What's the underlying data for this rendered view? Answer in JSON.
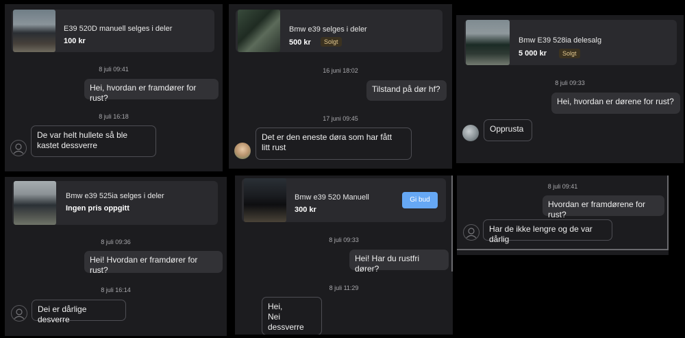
{
  "panels": [
    {
      "listing": {
        "title": "E39 520D manuell selges i deler",
        "price": "100 kr"
      },
      "messages": [
        {
          "time": "8 juli 09:41",
          "text": "Hei, hvordan er framdører for rust?"
        },
        {
          "time": "8 juli 16:18",
          "text": "De var helt hullete så ble\nkastet dessverre"
        }
      ]
    },
    {
      "listing": {
        "title": "Bmw e39 selges i deler",
        "price": "500 kr",
        "badge": "Solgt"
      },
      "messages": [
        {
          "time": "16 juni 18:02",
          "text": "Tilstand på dør hf?"
        },
        {
          "time": "17 juni 09:45",
          "text": "Det er den eneste døra som har fått\nlitt rust"
        }
      ]
    },
    {
      "listing": {
        "title": "Bmw E39 528ia delesalg",
        "price": "5 000 kr",
        "badge": "Solgt"
      },
      "messages": [
        {
          "time": "8 juli 09:33",
          "text": "Hei, hvordan er dørene for rust?"
        },
        {
          "text": "Opprusta"
        }
      ]
    },
    {
      "listing": {
        "title": "Bmw e39 525ia selges i deler",
        "price": "Ingen pris oppgitt"
      },
      "messages": [
        {
          "time": "8 juli 09:36",
          "text": "Hei! Hvordan er framdører for rust?"
        },
        {
          "time": "8 juli 16:14",
          "text": "Dei er dårlige desverre"
        }
      ]
    },
    {
      "listing": {
        "title": "Bmw e39 520 Manuell",
        "price": "300 kr",
        "action": "Gi bud"
      },
      "messages": [
        {
          "time": "8 juli 09:33",
          "text": "Hei! Har du rustfri dører?"
        },
        {
          "time": "8 juli 11:29",
          "text": "Hei,\nNei dessverre"
        }
      ]
    },
    {
      "messages": [
        {
          "time": "8 juli 09:41",
          "text": "Hvordan er framdørene for rust?"
        },
        {
          "text": "Har de ikke lengre og de var dårlig"
        }
      ]
    }
  ]
}
